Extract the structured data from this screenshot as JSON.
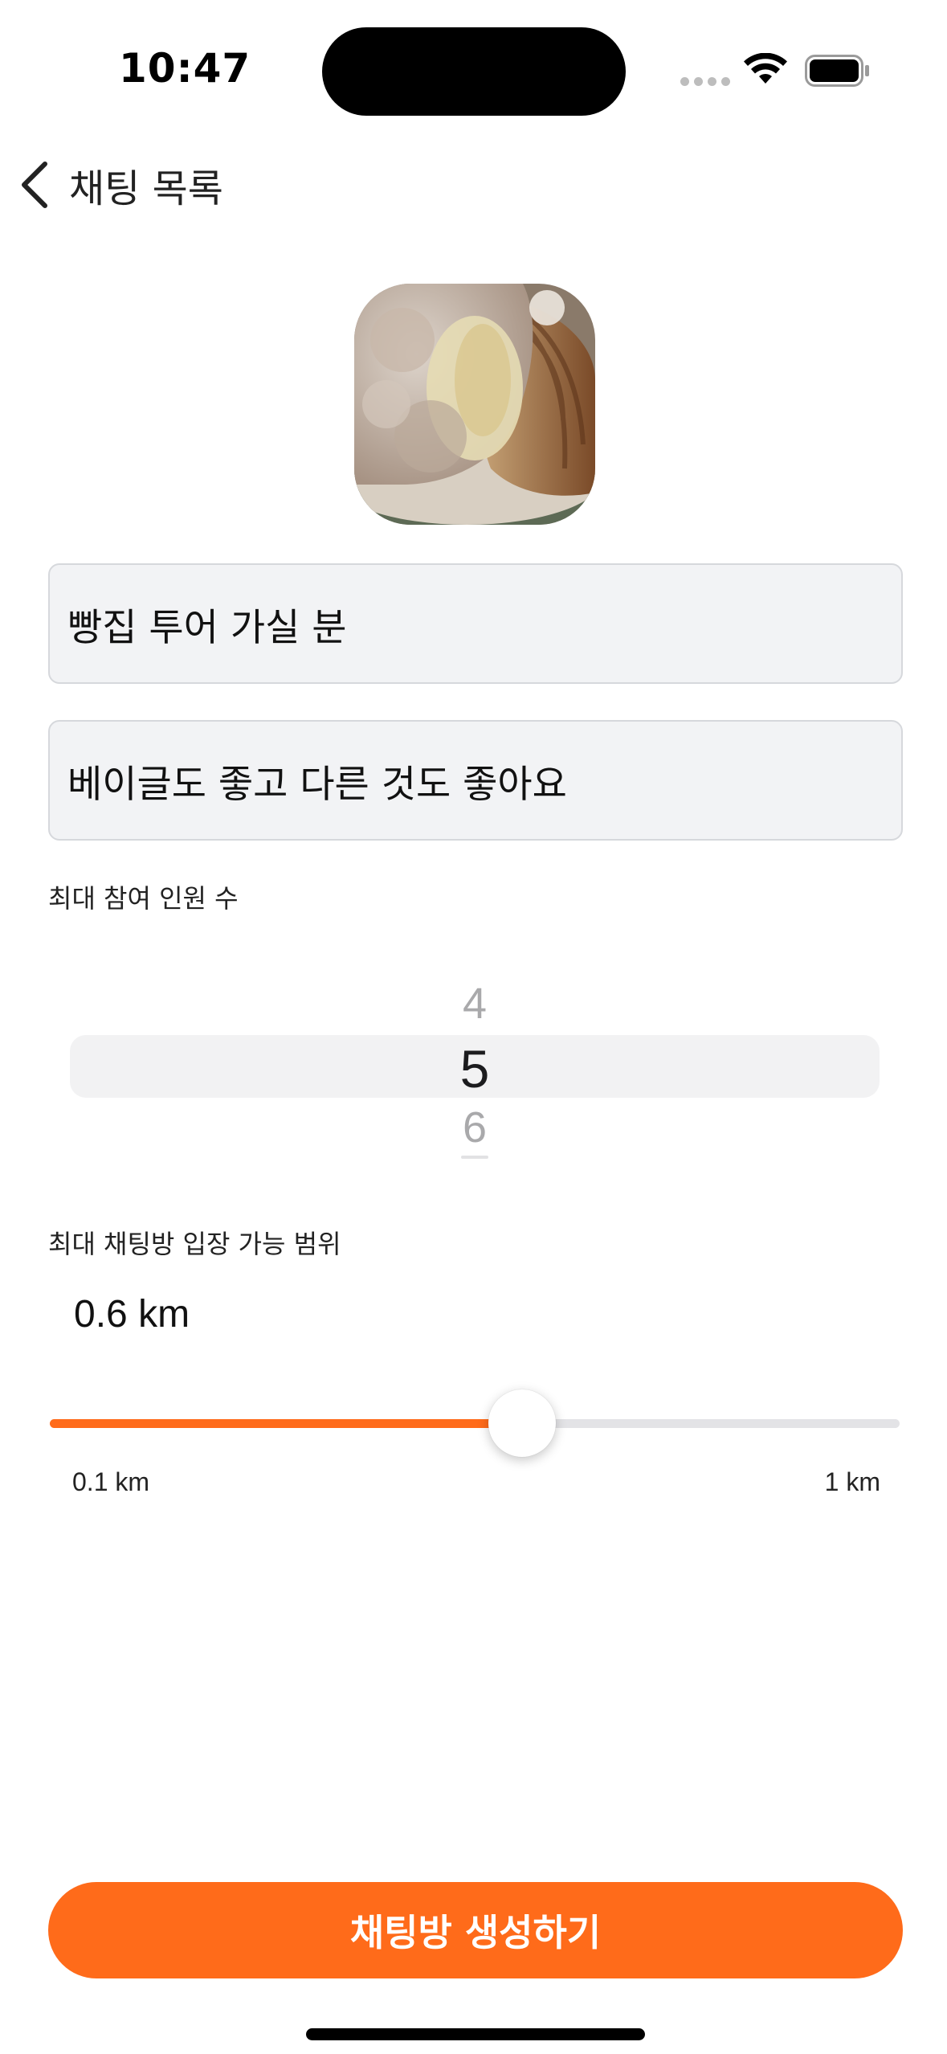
{
  "status_bar": {
    "time": "10:47"
  },
  "nav": {
    "back_label": "채팅 목록",
    "back_icon": "chevron-left-icon"
  },
  "form": {
    "title_value": "빵집 투어 가실 분",
    "description_value": "베이글도 좋고 다른 것도 좋아요",
    "participants_label": "최대 참여 인원 수",
    "participants_picker": {
      "prev": "4",
      "selected": "5",
      "next": "6"
    },
    "range_label": "최대  채팅방 입장 가능 범위",
    "range_value": "0.6 km",
    "range_min_label": "0.1 km",
    "range_max_label": "1 km",
    "range_fraction": 0.5556
  },
  "submit": {
    "label": "채팅방 생성하기"
  },
  "colors": {
    "accent": "#ff6b1a",
    "field_bg": "#f2f3f5"
  }
}
